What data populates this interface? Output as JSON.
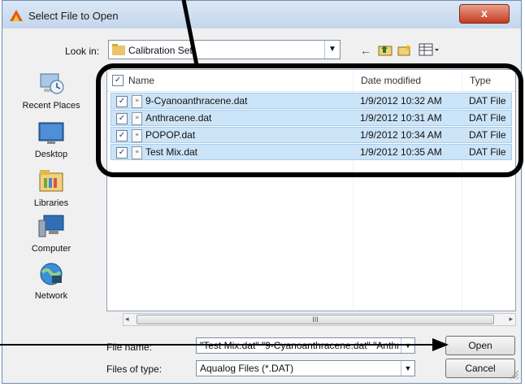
{
  "window": {
    "title": "Select File to Open",
    "close_label": "x"
  },
  "look_in": {
    "label": "Look in:",
    "value": "Calibration Set"
  },
  "places": [
    {
      "label": "Recent Places",
      "icon": "recent-places-icon"
    },
    {
      "label": "Desktop",
      "icon": "desktop-icon"
    },
    {
      "label": "Libraries",
      "icon": "libraries-icon"
    },
    {
      "label": "Computer",
      "icon": "computer-icon"
    },
    {
      "label": "Network",
      "icon": "network-icon"
    }
  ],
  "file_list": {
    "columns": [
      "Name",
      "Date modified",
      "Type"
    ],
    "rows": [
      {
        "name": "9-Cyanoanthracene.dat",
        "date": "1/9/2012 10:32 AM",
        "type": "DAT File",
        "checked": true
      },
      {
        "name": "Anthracene.dat",
        "date": "1/9/2012 10:31 AM",
        "type": "DAT File",
        "checked": true
      },
      {
        "name": "POPOP.dat",
        "date": "1/9/2012 10:34 AM",
        "type": "DAT File",
        "checked": true
      },
      {
        "name": "Test Mix.dat",
        "date": "1/9/2012 10:35 AM",
        "type": "DAT File",
        "checked": true
      }
    ]
  },
  "filename": {
    "label": "File name:",
    "value": "\"Test Mix.dat\" \"9-Cyanoanthracene.dat\" \"Anthr"
  },
  "filetype": {
    "label": "Files of type:",
    "value": "Aqualog Files (*.DAT)"
  },
  "buttons": {
    "open": "Open",
    "cancel": "Cancel"
  },
  "scroll_grip": "III"
}
